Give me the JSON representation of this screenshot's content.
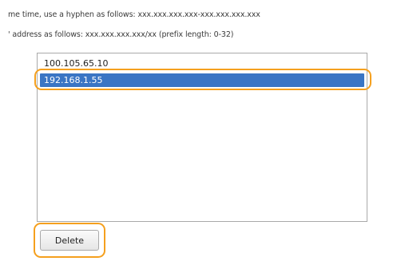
{
  "instructions": {
    "line1": "me time, use a hyphen as follows: xxx.xxx.xxx.xxx-xxx.xxx.xxx.xxx",
    "line2": "' address as follows: xxx.xxx.xxx.xxx/xx (prefix length: 0-32)"
  },
  "address_list": {
    "items": [
      {
        "label": "100.105.65.10",
        "selected": false
      },
      {
        "label": "192.168.1.55",
        "selected": true
      }
    ]
  },
  "actions": {
    "delete_label": "Delete"
  },
  "colors": {
    "highlight_outline": "#f5a01e",
    "selection_background": "#3a75c4"
  }
}
